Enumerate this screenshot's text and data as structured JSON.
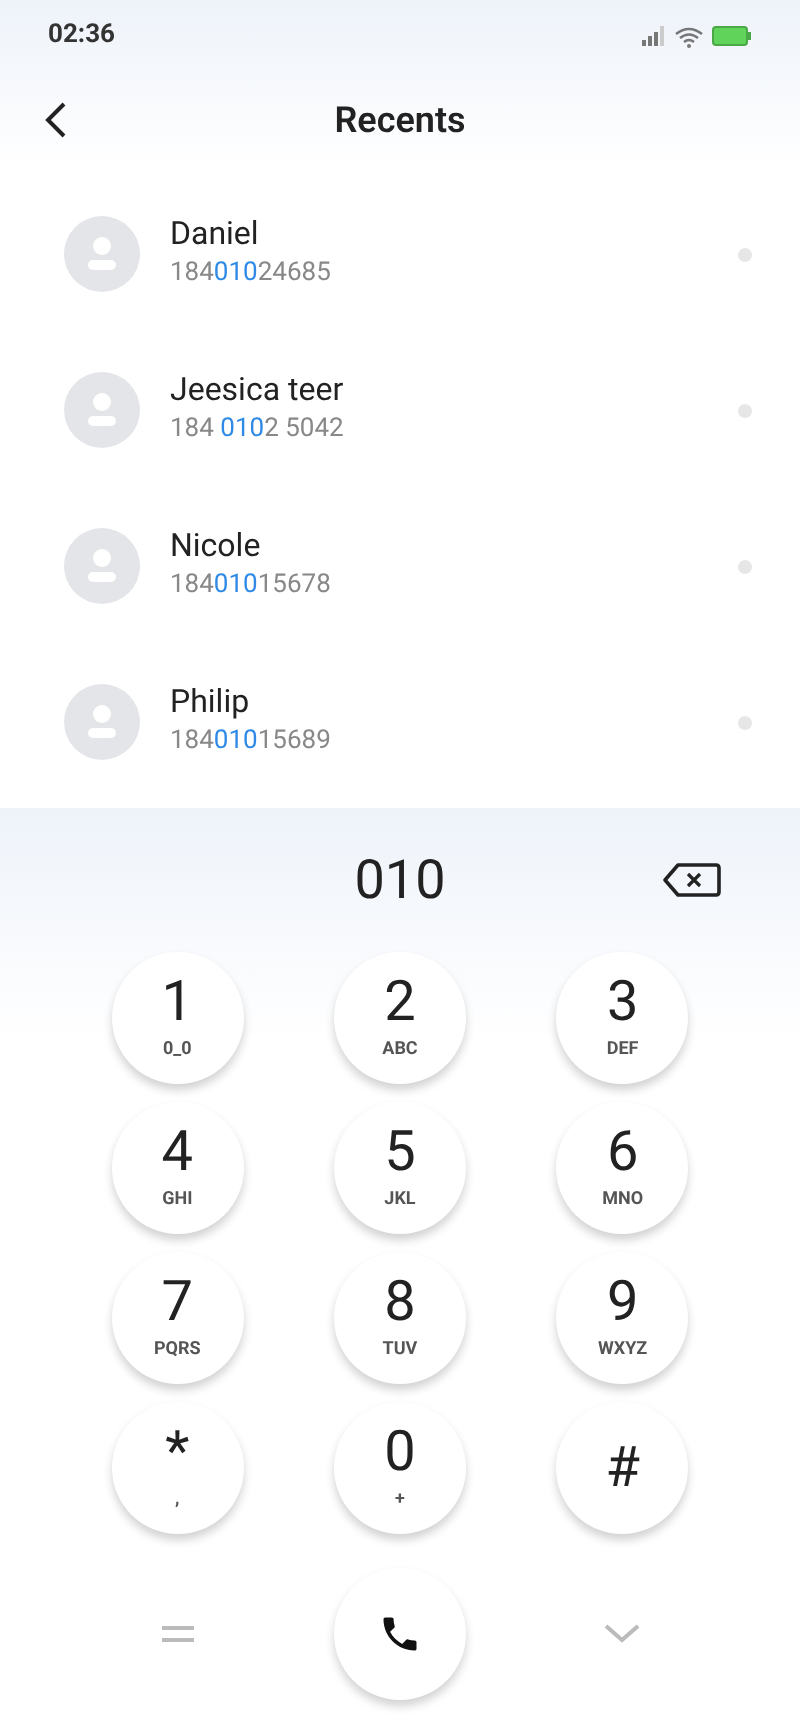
{
  "status_bar": {
    "time": "02:36"
  },
  "header": {
    "title": "Recents"
  },
  "contacts": [
    {
      "name": "Daniel",
      "number": {
        "before": "184",
        "match": "010",
        "after": "24685"
      }
    },
    {
      "name": "Jeesica teer",
      "number": {
        "before": "184 ",
        "match": "010",
        "after": "2 5042"
      }
    },
    {
      "name": "Nicole",
      "number": {
        "before": "184",
        "match": "010",
        "after": "15678"
      }
    },
    {
      "name": "Philip",
      "number": {
        "before": "184",
        "match": "010",
        "after": "15689"
      }
    }
  ],
  "dialer": {
    "input": "010",
    "keys": [
      {
        "digit": "1",
        "letters": "0_0"
      },
      {
        "digit": "2",
        "letters": "ABC"
      },
      {
        "digit": "3",
        "letters": "DEF"
      },
      {
        "digit": "4",
        "letters": "GHI"
      },
      {
        "digit": "5",
        "letters": "JKL"
      },
      {
        "digit": "6",
        "letters": "MNO"
      },
      {
        "digit": "7",
        "letters": "PQRS"
      },
      {
        "digit": "8",
        "letters": "TUV"
      },
      {
        "digit": "9",
        "letters": "WXYZ"
      },
      {
        "digit": "*",
        "letters": ","
      },
      {
        "digit": "0",
        "letters": "+"
      },
      {
        "digit": "#"
      }
    ]
  }
}
